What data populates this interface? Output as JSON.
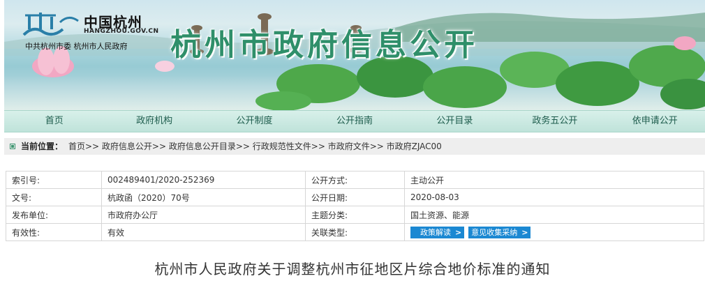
{
  "logo": {
    "title": "中国杭州",
    "domain": "HANGZHOU.GOV.CN",
    "org": "中共杭州市委  杭州市人民政府",
    "icon": "hangzhou-emblem-icon"
  },
  "site_title": "杭州市政府信息公开",
  "nav": {
    "items": [
      {
        "label": "首页"
      },
      {
        "label": "政府机构"
      },
      {
        "label": "公开制度"
      },
      {
        "label": "公开指南"
      },
      {
        "label": "公开目录"
      },
      {
        "label": "政务五公开"
      },
      {
        "label": "依申请公开"
      }
    ]
  },
  "breadcrumb": {
    "label": "当前位置：",
    "path": "首页>> 政府信息公开>> 政府信息公开目录>> 行政规范性文件>> 市政府文件>> 市政府ZJAC00"
  },
  "info": {
    "rows": [
      {
        "k1": "索引号:",
        "v1": "002489401/2020-252369",
        "k2": "公开方式:",
        "v2": "主动公开"
      },
      {
        "k1": "文号:",
        "v1": "杭政函（2020）70号",
        "k2": "公开日期:",
        "v2": "2020-08-03"
      },
      {
        "k1": "发布单位:",
        "v1": "市政府办公厅",
        "k2": "主题分类:",
        "v2": "国土资源、能源"
      },
      {
        "k1": "有效性:",
        "v1": "有效",
        "k2": "关联类型:"
      }
    ],
    "buttons": {
      "policy": "政策解读",
      "opinion": "意见收集采纳",
      "arrow": ">"
    }
  },
  "doc_title": "杭州市人民政府关于调整杭州市征地区片综合地价标准的通知",
  "colors": {
    "nav_bg": "#c8e8e0",
    "title_green": "#2f8f6a",
    "button_blue": "#1b88d2"
  }
}
